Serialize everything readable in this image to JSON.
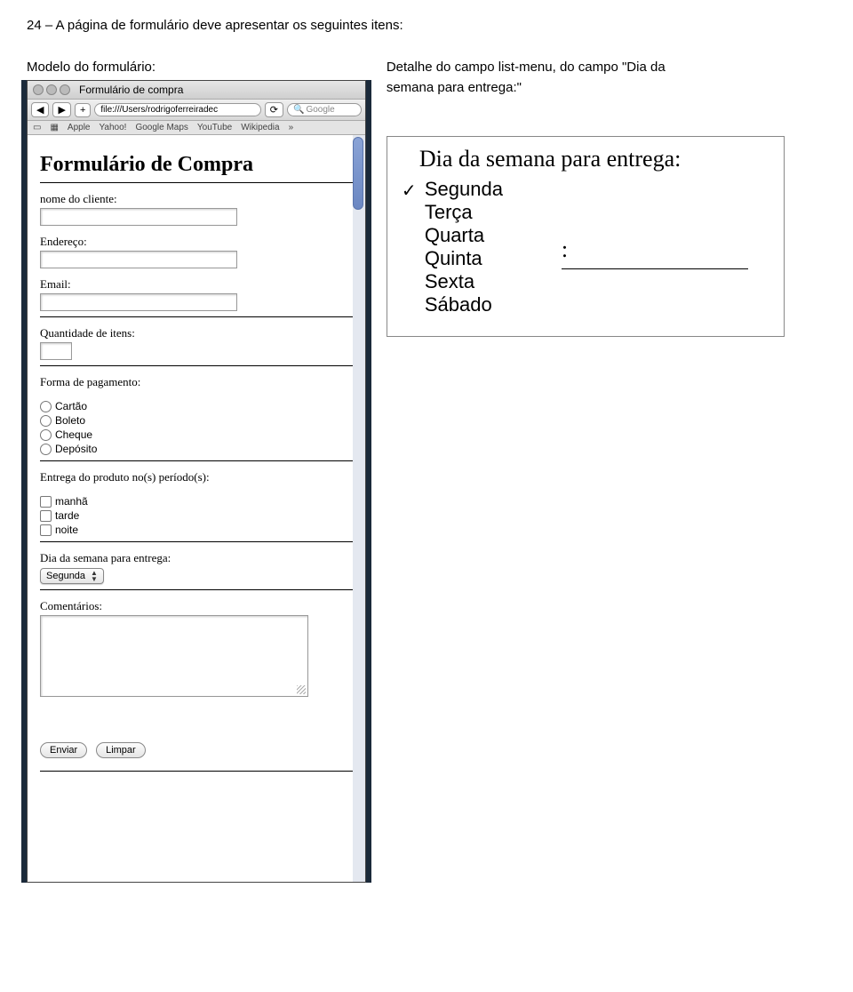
{
  "doc": {
    "top_line": "24 – A página de formulário deve apresentar os seguintes itens:",
    "caption_left": "Modelo do formulário:",
    "caption_right_line1": "Detalhe do campo list-menu, do campo \"Dia da",
    "caption_right_line2": "semana para entrega:\""
  },
  "browser": {
    "window_title": "Formulário de compra",
    "address": "file:///Users/rodrigoferreiradec",
    "search_placeholder": "Google",
    "bookmarks": [
      "Apple",
      "Yahoo!",
      "Google Maps",
      "YouTube",
      "Wikipedia"
    ],
    "overflow": "»"
  },
  "form": {
    "title": "Formulário de Compra",
    "label_nome": "nome do cliente:",
    "label_endereco": "Endereço:",
    "label_email": "Email:",
    "label_qtd": "Quantidade de itens:",
    "label_pagamento": "Forma de pagamento:",
    "pay_options": [
      "Cartão",
      "Boleto",
      "Cheque",
      "Depósito"
    ],
    "label_periodo": "Entrega do produto no(s) período(s):",
    "period_options": [
      "manhã",
      "tarde",
      "noite"
    ],
    "label_dia": "Dia da semana para entrega:",
    "select_value": "Segunda",
    "label_coment": "Comentários:",
    "btn_enviar": "Enviar",
    "btn_limpar": "Limpar"
  },
  "detail": {
    "label": "Dia da semana para entrega:",
    "options": [
      "Segunda",
      "Terça",
      "Quarta",
      "Quinta",
      "Sexta",
      "Sábado"
    ],
    "checked_index": 0,
    "behind_suffix": ":"
  }
}
